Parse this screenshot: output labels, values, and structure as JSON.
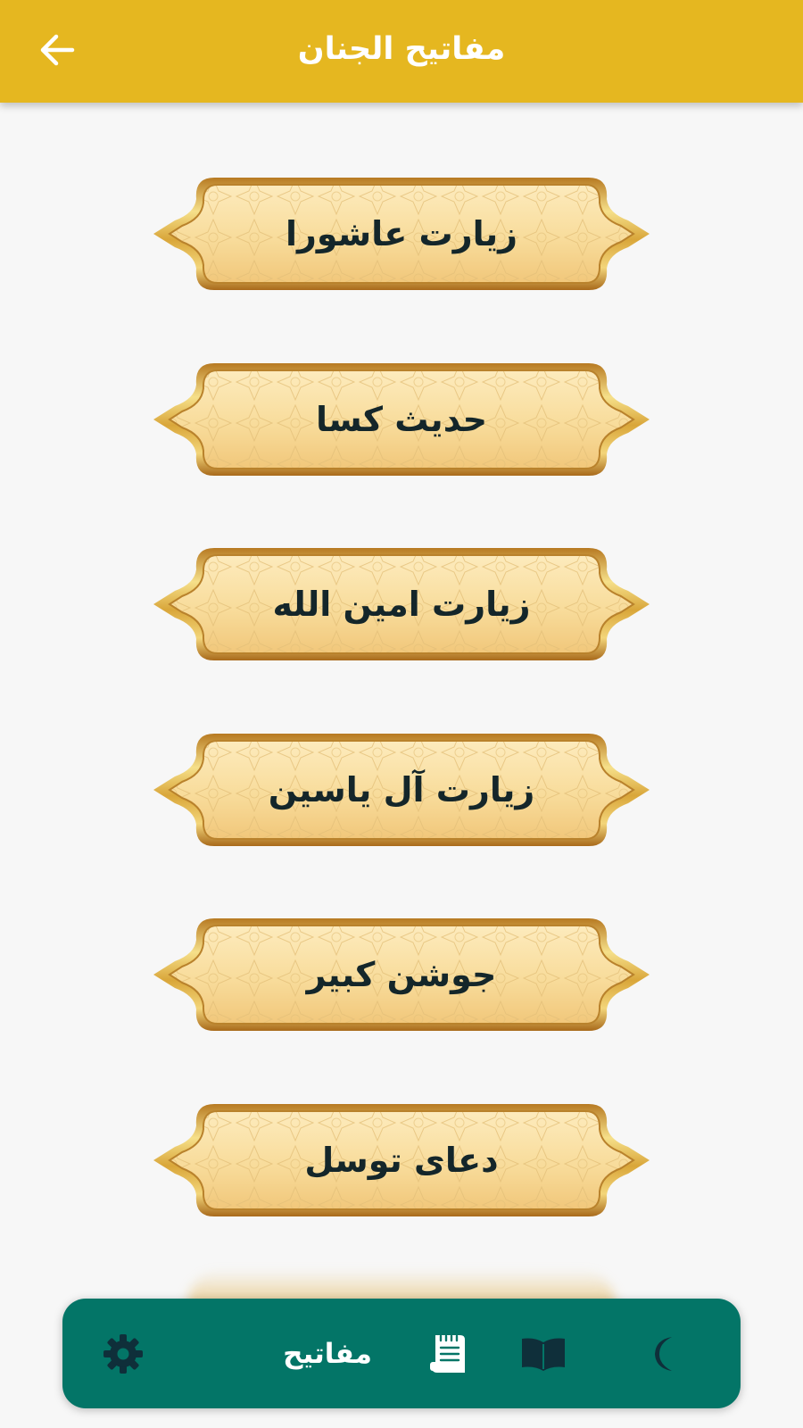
{
  "app_bar": {
    "title": "مفاتیح الجنان",
    "back_icon": "arrow-left-icon"
  },
  "colors": {
    "app_bar": "#e5b720",
    "bottom_nav": "#037567",
    "background": "#f7f7f7",
    "button_fill": "#f6d995",
    "button_border": "#c58a2b",
    "label_text": "#14262a"
  },
  "menu": {
    "items": [
      {
        "label": "زیارت عاشورا"
      },
      {
        "label": "حدیث کسا"
      },
      {
        "label": "زیارت امین الله"
      },
      {
        "label": "زیارت آل یاسین"
      },
      {
        "label": "جوشن کبیر"
      },
      {
        "label": "دعای توسل"
      }
    ]
  },
  "bottom_nav": {
    "items": [
      {
        "icon": "gear-icon"
      },
      {
        "label": "مفاتیح",
        "icon": "document-icon",
        "selected": true
      },
      {
        "icon": "open-book-icon"
      },
      {
        "icon": "crescent-moon-icon"
      }
    ]
  }
}
